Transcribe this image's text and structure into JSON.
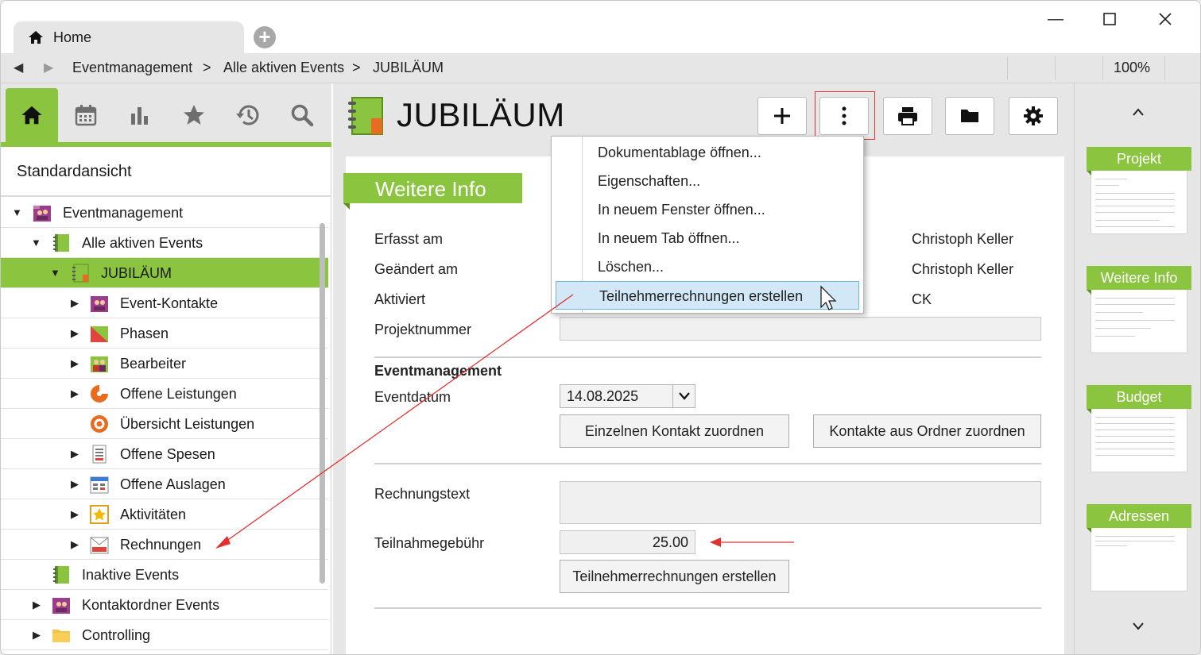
{
  "window": {
    "tab_label": "Home",
    "zoom": "100%"
  },
  "breadcrumb": [
    "Eventmanagement",
    "Alle aktiven Events",
    "JUBILÄUM"
  ],
  "sidebar": {
    "view_name": "Standardansicht",
    "tree": [
      {
        "label": "Eventmanagement",
        "icon": "contacts-folder-icon",
        "level": 0,
        "expanded": true
      },
      {
        "label": "Alle aktiven Events",
        "icon": "notebook-icon",
        "level": 1,
        "expanded": true
      },
      {
        "label": "JUBILÄUM",
        "icon": "notebook-icon",
        "level": 2,
        "expanded": true,
        "selected": true
      },
      {
        "label": "Event-Kontakte",
        "icon": "contacts-icon",
        "level": 3,
        "expanded": false
      },
      {
        "label": "Phasen",
        "icon": "phases-icon",
        "level": 3,
        "expanded": false
      },
      {
        "label": "Bearbeiter",
        "icon": "people-icon",
        "level": 3,
        "expanded": false
      },
      {
        "label": "Offene Leistungen",
        "icon": "pie-icon",
        "level": 3,
        "expanded": false
      },
      {
        "label": "Übersicht Leistungen",
        "icon": "target-icon",
        "level": 3,
        "expanded": null
      },
      {
        "label": "Offene Spesen",
        "icon": "receipt-icon",
        "level": 3,
        "expanded": false
      },
      {
        "label": "Offene Auslagen",
        "icon": "expenses-icon",
        "level": 3,
        "expanded": false
      },
      {
        "label": "Aktivitäten",
        "icon": "star-icon",
        "level": 3,
        "expanded": false
      },
      {
        "label": "Rechnungen",
        "icon": "invoice-icon",
        "level": 3,
        "expanded": false
      },
      {
        "label": "Inaktive Events",
        "icon": "notebook-icon",
        "level": 1,
        "expanded": null
      },
      {
        "label": "Kontaktordner Events",
        "icon": "contacts-folder-icon",
        "level": 1,
        "expanded": false
      },
      {
        "label": "Controlling",
        "icon": "folder-icon",
        "level": 1,
        "expanded": false
      }
    ]
  },
  "document": {
    "title": "JUBILÄUM",
    "section_title": "Weitere Info",
    "fields": {
      "erfasst_label": "Erfasst am",
      "geaendert_label": "Geändert am",
      "aktiviert_label": "Aktiviert",
      "projektnummer_label": "Projektnummer",
      "erfasst_user": "Christoph Keller",
      "geaendert_user": "Christoph Keller",
      "aktiviert_user": "CK",
      "group_title": "Eventmanagement",
      "eventdatum_label": "Eventdatum",
      "eventdatum_value": "14.08.2025",
      "rechnungstext_label": "Rechnungstext",
      "gebuehr_label": "Teilnahmegebühr",
      "gebuehr_value": "25.00"
    },
    "buttons": {
      "einzelkontakt": "Einzelnen Kontakt zuordnen",
      "ordnerkontakte": "Kontakte aus Ordner zuordnen",
      "rechnungen": "Teilnehmerrechnungen erstellen"
    }
  },
  "menu": {
    "items": [
      "Dokumentablage öffnen...",
      "Eigenschaften...",
      "In neuem Fenster öffnen...",
      "In neuem Tab öffnen...",
      "Löschen...",
      "Teilnehmerrechnungen erstellen"
    ],
    "hovered_index": 5
  },
  "thumbnails": [
    "Projekt",
    "Weitere Info",
    "Budget",
    "Adressen"
  ],
  "colors": {
    "accent_green": "#8bc43f",
    "annotation_red": "#e0322e",
    "menu_hover": "#d2e8f6"
  }
}
